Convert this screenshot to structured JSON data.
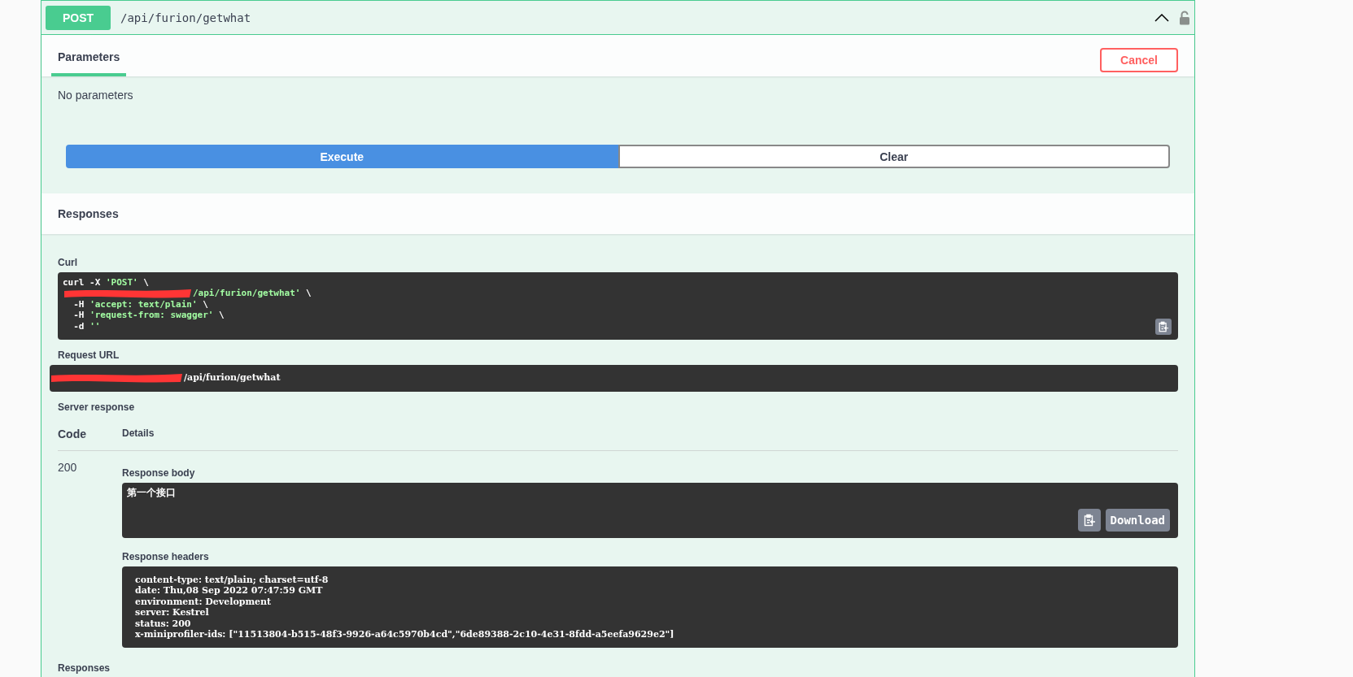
{
  "operation": {
    "method": "POST",
    "path": "/api/furion/getwhat",
    "expanded": true,
    "locked": false
  },
  "tabs": [
    {
      "label": "Parameters",
      "selected": true
    }
  ],
  "cancel_button": "Cancel",
  "parameters_text": "No parameters",
  "buttons": [
    {
      "label": "Execute",
      "kind": "primary"
    },
    {
      "label": "Clear",
      "kind": "secondary"
    }
  ],
  "responses_title": "Responses",
  "curl": {
    "label": "Curl",
    "lines": [
      {
        "redacted": false,
        "tokens": [
          {
            "kind": "plain",
            "text": "curl -X "
          },
          {
            "kind": "string",
            "text": "'POST'"
          },
          {
            "kind": "plain",
            "text": " \\"
          }
        ]
      },
      {
        "redacted": true,
        "tokens": [
          {
            "kind": "string",
            "text": "/api/furion/getwhat'"
          },
          {
            "kind": "plain",
            "text": " \\"
          }
        ]
      },
      {
        "redacted": false,
        "tokens": [
          {
            "kind": "plain",
            "text": "  -H "
          },
          {
            "kind": "string",
            "text": "'accept: text/plain'"
          },
          {
            "kind": "plain",
            "text": " \\"
          }
        ]
      },
      {
        "redacted": false,
        "tokens": [
          {
            "kind": "plain",
            "text": "  -H "
          },
          {
            "kind": "string",
            "text": "'request-from: swagger'"
          },
          {
            "kind": "plain",
            "text": " \\"
          }
        ]
      },
      {
        "redacted": false,
        "tokens": [
          {
            "kind": "plain",
            "text": "  -d "
          },
          {
            "kind": "string",
            "text": "''"
          }
        ]
      }
    ]
  },
  "request_url": {
    "label": "Request URL",
    "redacted": true,
    "value": "/api/furion/getwhat"
  },
  "server_response": {
    "label": "Server response",
    "columns": [
      "Code",
      "Details"
    ],
    "rows": [
      {
        "code": "200",
        "body_label": "Response body",
        "body": "第一个接口",
        "download": "Download",
        "headers_label": "Response headers",
        "headers": [
          "content-type: text/plain; charset=utf-8",
          "date: Thu,08 Sep 2022 07:47:59 GMT",
          "environment: Development",
          "server: Kestrel",
          "status: 200",
          "x-miniprofiler-ids: [\"11513804-b515-48f3-9926-a64c5970b4cd\",\"6de89388-2c10-4e31-8fdd-a5eefa9629e2\"]"
        ]
      }
    ]
  },
  "footer_title": "Responses"
}
